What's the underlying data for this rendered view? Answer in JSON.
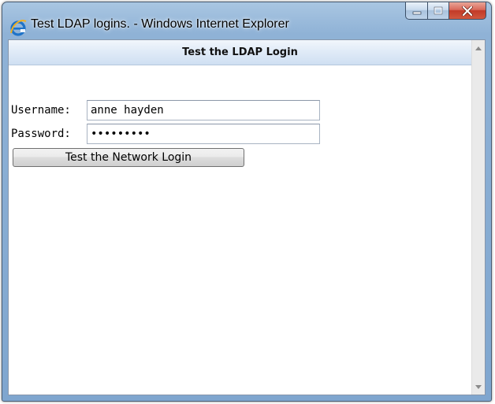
{
  "window": {
    "title": "Test LDAP logins. - Windows Internet Explorer"
  },
  "page": {
    "heading": "Test the LDAP Login"
  },
  "form": {
    "username_label": "Username:",
    "username_value": "anne hayden",
    "password_label": "Password:",
    "password_mask": "•••••••••",
    "submit_label": "Test the Network Login"
  },
  "icons": {
    "app": "internet-explorer-icon",
    "minimize": "minimize-icon",
    "maximize": "maximize-icon",
    "close": "close-icon",
    "scroll_up": "scroll-up-arrow-icon",
    "scroll_down": "scroll-down-arrow-icon"
  },
  "colors": {
    "titlebar": "#8fb2d6",
    "close_button": "#c9432f",
    "header_bar": "#dfeaf7"
  }
}
